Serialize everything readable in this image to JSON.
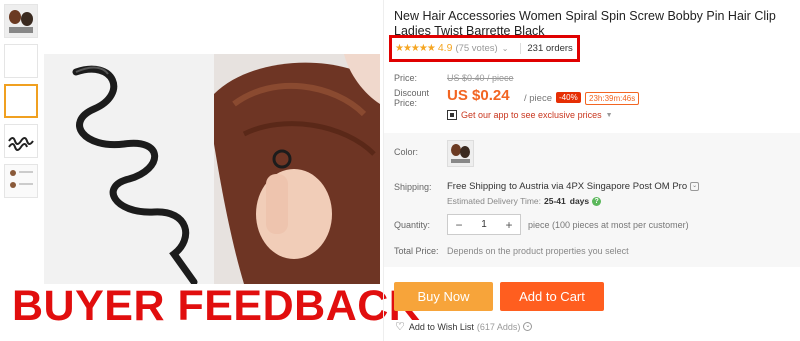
{
  "product": {
    "title": "New Hair Accessories Women Spiral Spin Screw Bobby Pin Hair Clip Ladies Twist Barrette Black",
    "rating": {
      "stars": "★★★★★",
      "score": "4.9",
      "votes": "(75 votes)",
      "orders": "231 orders"
    }
  },
  "price": {
    "label": "Price:",
    "old": "US $0.40 / piece",
    "discount_label": "Discount Price:",
    "new": "US $0.24",
    "unit": "/ piece",
    "off": "-40%",
    "timer": "23h:39m:46s",
    "app_promo": "Get our app to see exclusive prices"
  },
  "options": {
    "color_label": "Color:",
    "shipping_label": "Shipping:",
    "shipping_free": "Free Shipping",
    "shipping_dest": "to Austria via 4PX Singapore Post OM Pro",
    "delivery_label": "Estimated Delivery Time:",
    "delivery_value": "25-41",
    "delivery_unit": "days",
    "quantity_label": "Quantity:",
    "quantity_value": "1",
    "quantity_minus": "−",
    "quantity_plus": "+",
    "quantity_note": "piece (100 pieces at most per customer)",
    "total_label": "Total Price:",
    "total_text": "Depends on the product properties you select"
  },
  "actions": {
    "buy_now": "Buy Now",
    "add_to_cart": "Add to Cart",
    "wishlist": "Add to Wish List",
    "wishlist_count": "(617 Adds)"
  },
  "overlay": {
    "watermark": "BUYER FEEDBACK"
  },
  "colors": {
    "accent_orange": "#f26522",
    "buy_now_bg": "#f7a43a",
    "add_to_cart_bg": "#ff5e1f",
    "highlight_red": "#e00000",
    "star": "#f5a623"
  }
}
